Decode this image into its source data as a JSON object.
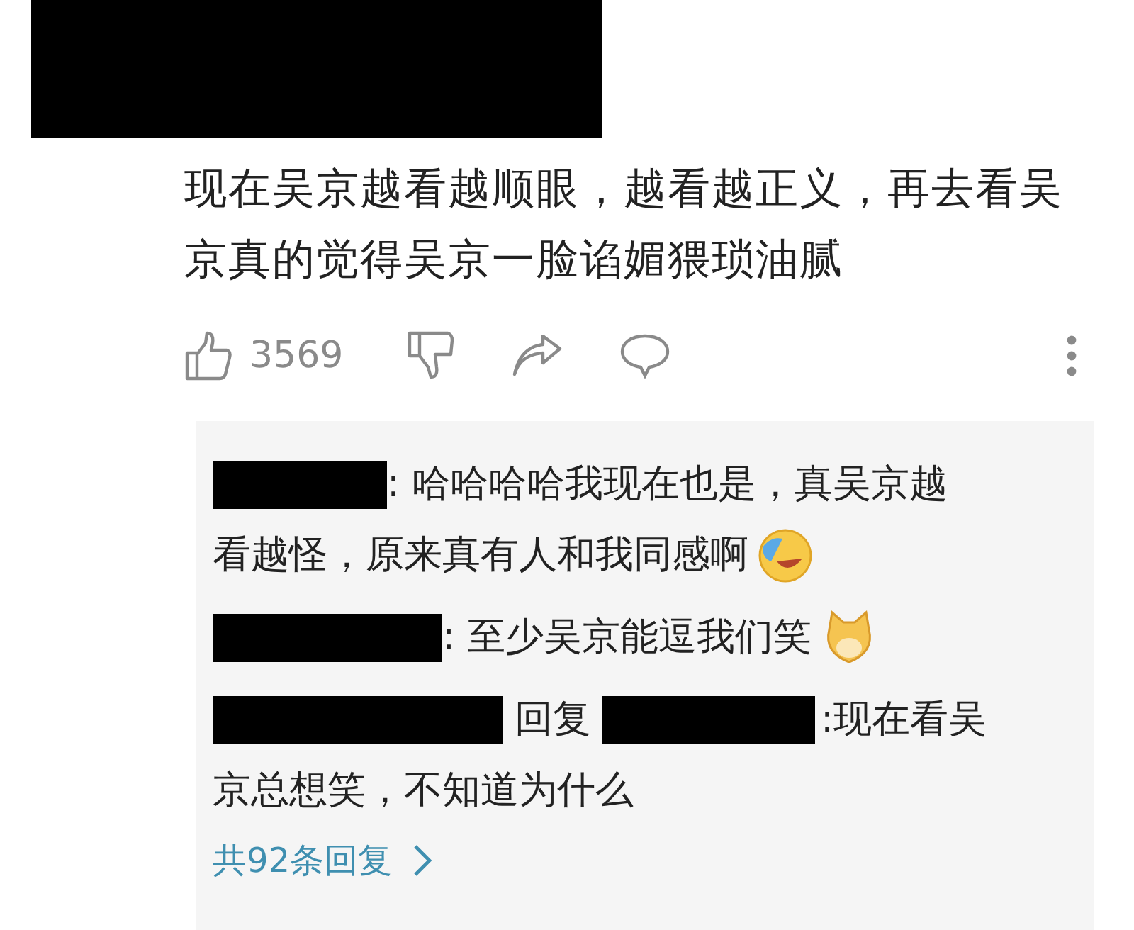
{
  "comment": {
    "text": "现在吴京越看越顺眼，越看越正义，再去看吴京真的觉得吴京一脸谄媚猥琐油腻",
    "likes": "3569"
  },
  "replies": [
    {
      "kind": "laughing",
      "lines": [
        ": 哈哈哈哈我现在也是，真吴京越",
        "看越怪，原来真有人和我同感啊"
      ]
    },
    {
      "kind": "dog",
      "lines": [
        ": 至少吴京能逗我们笑"
      ]
    },
    {
      "kind": "reply_to",
      "reply_word": "回复",
      "lines": [
        ":现在看吴",
        "京总想笑，不知道为什么"
      ]
    }
  ],
  "more_replies": "共92条回复"
}
